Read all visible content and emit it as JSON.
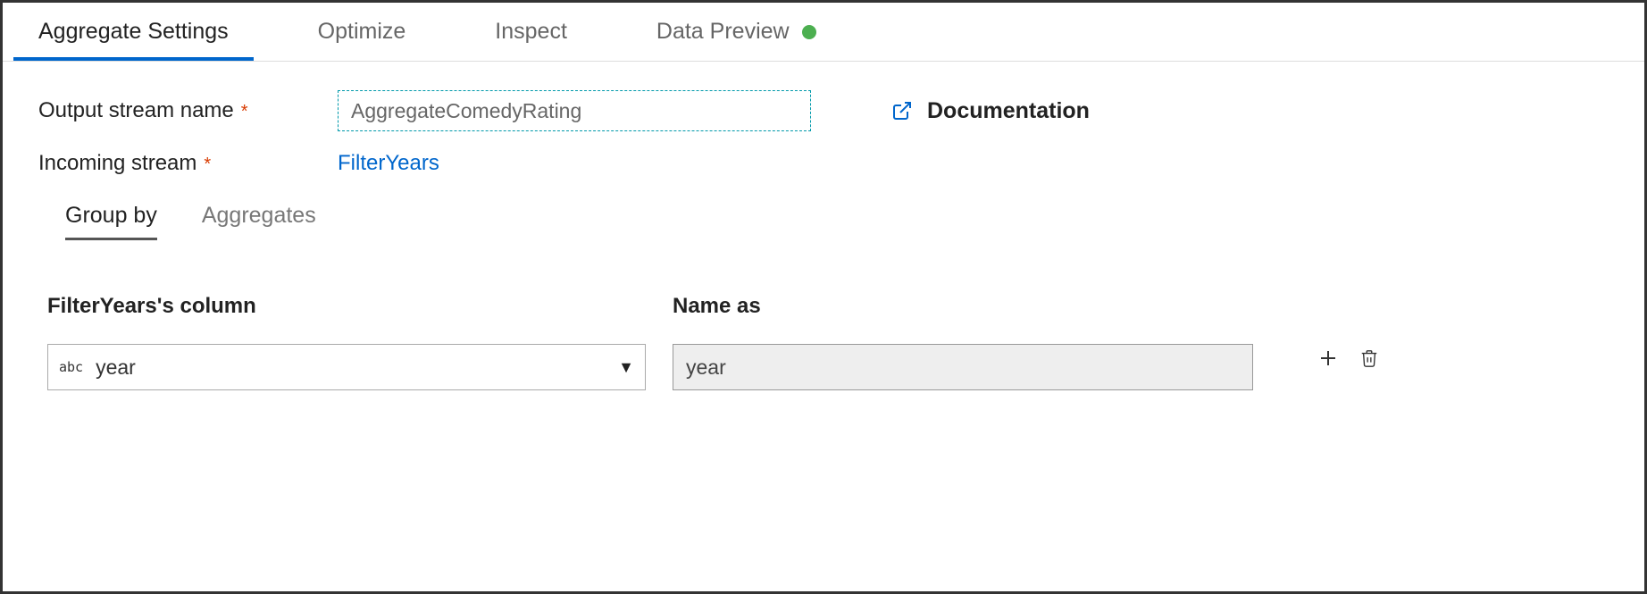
{
  "tabs": {
    "main": [
      {
        "label": "Aggregate Settings",
        "active": true
      },
      {
        "label": "Optimize",
        "active": false
      },
      {
        "label": "Inspect",
        "active": false
      },
      {
        "label": "Data Preview",
        "active": false,
        "status": "green"
      }
    ],
    "sub": [
      {
        "label": "Group by",
        "active": true
      },
      {
        "label": "Aggregates",
        "active": false
      }
    ]
  },
  "form": {
    "output_stream_label": "Output stream name",
    "output_stream_value": "AggregateComedyRating",
    "incoming_stream_label": "Incoming stream",
    "incoming_stream_value": "FilterYears",
    "documentation_label": "Documentation"
  },
  "columns": {
    "left_header": "FilterYears's column",
    "right_header": "Name as",
    "rows": [
      {
        "type_badge": "abc",
        "column_value": "year",
        "name_as_value": "year"
      }
    ]
  }
}
